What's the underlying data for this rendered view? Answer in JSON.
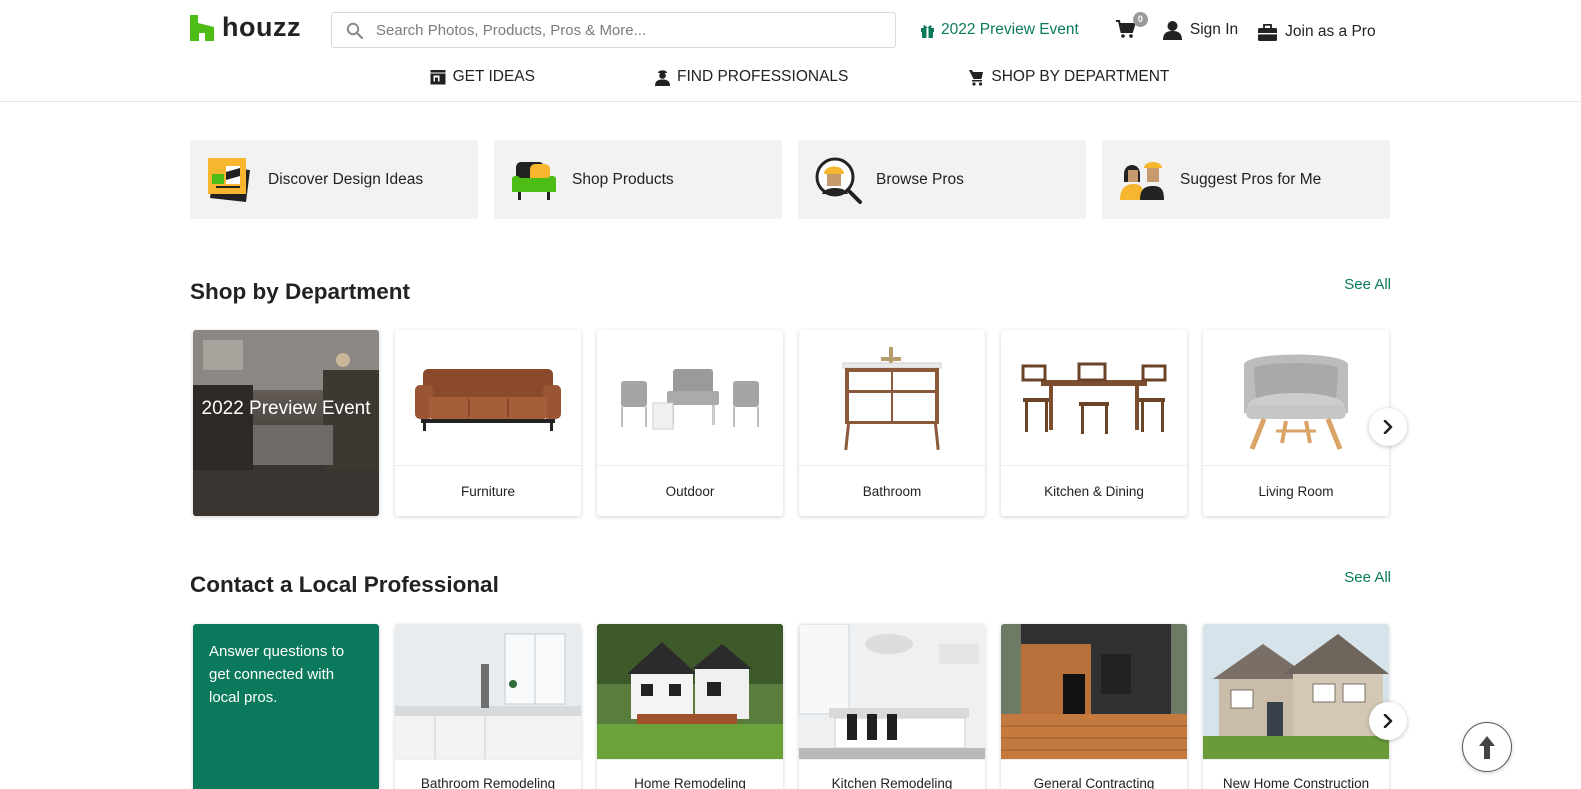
{
  "header": {
    "logo_text": "houzz",
    "search_placeholder": "Search Photos, Products, Pros & More...",
    "promo_link": "2022 Preview Event",
    "cart_count": "0",
    "sign_in": "Sign In",
    "join_pro": "Join as a Pro"
  },
  "nav": {
    "items": [
      {
        "label": "GET IDEAS",
        "icon": "ideas-icon"
      },
      {
        "label": "FIND PROFESSIONALS",
        "icon": "professional-icon"
      },
      {
        "label": "SHOP BY DEPARTMENT",
        "icon": "shopping-cart-icon"
      }
    ]
  },
  "quick_actions": [
    {
      "label": "Discover Design Ideas",
      "icon": "design-ideas-icon"
    },
    {
      "label": "Shop Products",
      "icon": "shop-products-icon"
    },
    {
      "label": "Browse Pros",
      "icon": "browse-pros-icon"
    },
    {
      "label": "Suggest Pros for Me",
      "icon": "suggest-pros-icon"
    }
  ],
  "shop_section": {
    "title": "Shop by Department",
    "see_all": "See All",
    "promo_tile": "2022 Preview Event",
    "departments": [
      "Furniture",
      "Outdoor",
      "Bathroom",
      "Kitchen & Dining",
      "Living Room"
    ]
  },
  "pro_section": {
    "title": "Contact a Local Professional",
    "see_all": "See All",
    "cta_text": "Answer questions to get connected with local pros.",
    "categories": [
      "Bathroom Remodeling",
      "Home Remodeling",
      "Kitchen Remodeling",
      "General Contracting",
      "New Home Construction"
    ]
  },
  "colors": {
    "brand_green": "#4dbc15",
    "accent_teal": "#0b7a5c"
  }
}
